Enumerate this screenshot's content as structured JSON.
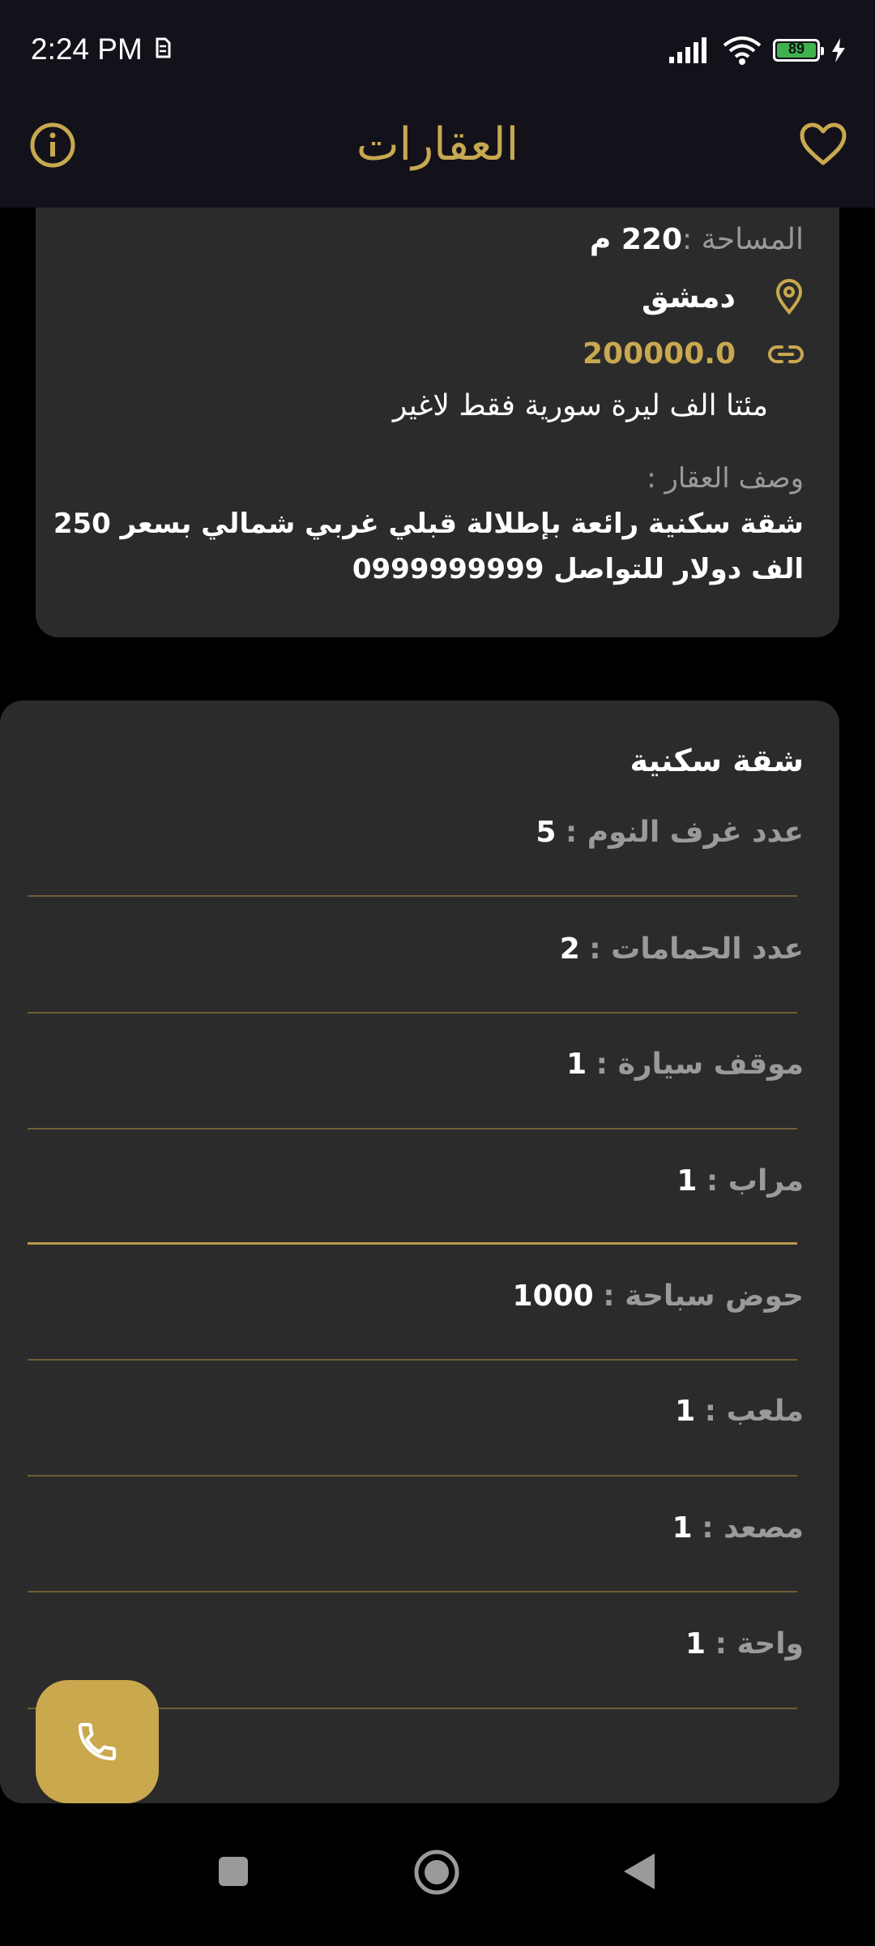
{
  "status": {
    "time": "2:24 PM",
    "battery": "89"
  },
  "appbar": {
    "title": "العقارات"
  },
  "details": {
    "area_label": "المساحة :",
    "area_value": "220 م",
    "city": "دمشق",
    "price": "200000.0",
    "price_words": "مئتا الف ليرة سورية فقط لاغير",
    "description_label": "وصف العقار :",
    "description_line1": "شقة سكنية رائعة بإطلالة قبلي غربي شمالي بسعر 250",
    "description_line2": "الف دولار للتواصل 0999999999"
  },
  "features": {
    "type": "شقة سكنية",
    "items": [
      {
        "label": "عدد غرف النوم  :",
        "value": "5"
      },
      {
        "label": "عدد الحمامات :",
        "value": "2"
      },
      {
        "label": "موقف سيارة :",
        "value": "1"
      },
      {
        "label": "مراب :",
        "value": "1"
      },
      {
        "label": "حوض سباحة :",
        "value": "1000"
      },
      {
        "label": "ملعب :",
        "value": "1"
      },
      {
        "label": "مصعد :",
        "value": "1"
      },
      {
        "label": "واحة :",
        "value": "1"
      }
    ]
  },
  "colors": {
    "accent": "#c8a850",
    "card": "#2b2b2b",
    "appbar": "#13121a"
  },
  "icons": [
    "info-icon",
    "heart-icon",
    "location-pin-icon",
    "link-icon",
    "phone-icon"
  ]
}
